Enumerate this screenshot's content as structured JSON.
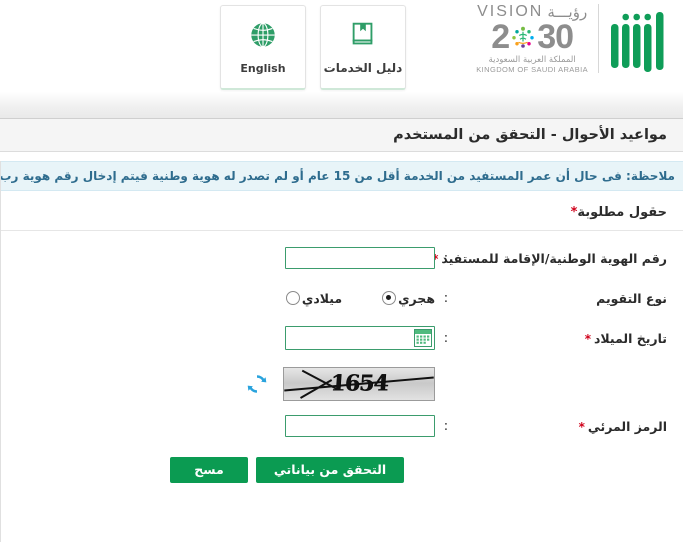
{
  "header": {
    "cards": [
      {
        "label": "English",
        "icon": "globe-icon",
        "lang": "en"
      },
      {
        "label": "دليل الخدمات",
        "icon": "book-icon",
        "lang": "ar"
      }
    ],
    "vision_logo": {
      "word_en": "VISION",
      "word_ar": "رؤيـــة",
      "year_left": "2",
      "year_right": "30",
      "subtitle_ar": "المملكة العربية السعودية",
      "subtitle_en": "KINGDOM OF SAUDI ARABIA"
    },
    "absher_logo": {
      "name": "absher-logo",
      "color": "#0f9d58"
    }
  },
  "title": "مواعيد الأحوال - التحقق من المستخدم",
  "note": "ملاحظة: فى حال أن عمر المستفيد من الخدمة أقل من 15 عام أو لم تصدر له هوية وطنية فيتم إدخال رقم هوية رب الأسرة.",
  "required_fields_label": "حقول مطلوبة",
  "required_star": "*",
  "form": {
    "id_field": {
      "label": "رقم الهوية الوطنية/الإقامة للمستفيد",
      "value": "",
      "placeholder": ""
    },
    "calendar_type": {
      "label": "نوع التقويم",
      "options": [
        {
          "label": "هجري",
          "selected": true
        },
        {
          "label": "ميلادي",
          "selected": false
        }
      ]
    },
    "birth_date": {
      "label": "تاريخ الميلاد",
      "value": "",
      "placeholder": "",
      "icon": "calendar-icon"
    },
    "captcha": {
      "text": "1654",
      "refresh_icon": "refresh-icon"
    },
    "captcha_field": {
      "label": "الرمز المرئي",
      "value": "",
      "placeholder": ""
    }
  },
  "buttons": {
    "verify": "التحقق من بياناتي",
    "clear": "مسح"
  },
  "colors": {
    "primary_green": "#0b9b52",
    "input_border_green": "#3b9c6d",
    "note_bg": "#e8f4f8",
    "note_text": "#2e6c8e",
    "required_red": "#d0021b",
    "refresh_blue": "#29a3dd"
  }
}
